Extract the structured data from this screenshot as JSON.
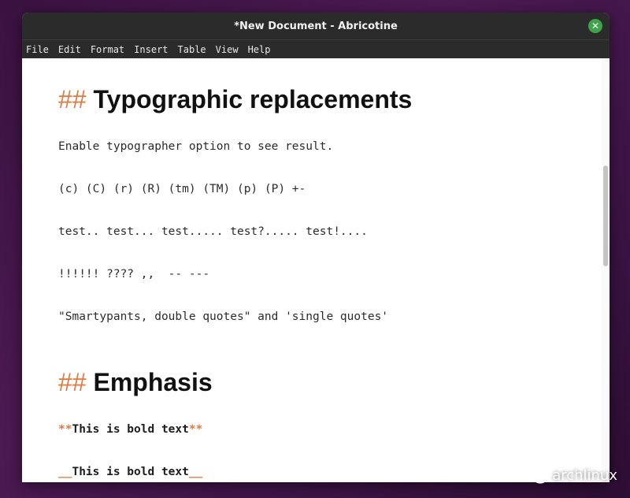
{
  "window": {
    "title": "*New Document - Abricotine"
  },
  "menu": [
    "File",
    "Edit",
    "Format",
    "Insert",
    "Table",
    "View",
    "Help"
  ],
  "document": {
    "heading1": {
      "marker": "##",
      "text": "Typographic replacements"
    },
    "lines": [
      "Enable typographer option to see result.",
      "(c) (C) (r) (R) (tm) (TM) (p) (P) +-",
      "test.. test... test..... test?..... test!....",
      "!!!!!! ???? ,,  -- ---",
      "\"Smartypants, double quotes\" and 'single quotes'"
    ],
    "heading2": {
      "marker": "##",
      "text": "Emphasis"
    },
    "bold1": {
      "open": "**",
      "text": "This is bold text",
      "close": "**"
    },
    "bold2": {
      "open": "__",
      "text": "This is bold text",
      "close": "__"
    }
  },
  "watermark": {
    "text": "archlinux",
    "icon": "wechat-icon"
  },
  "colors": {
    "accent": "#e07a3f",
    "titlebar": "#2b2b2b",
    "close": "#3ea34a"
  }
}
